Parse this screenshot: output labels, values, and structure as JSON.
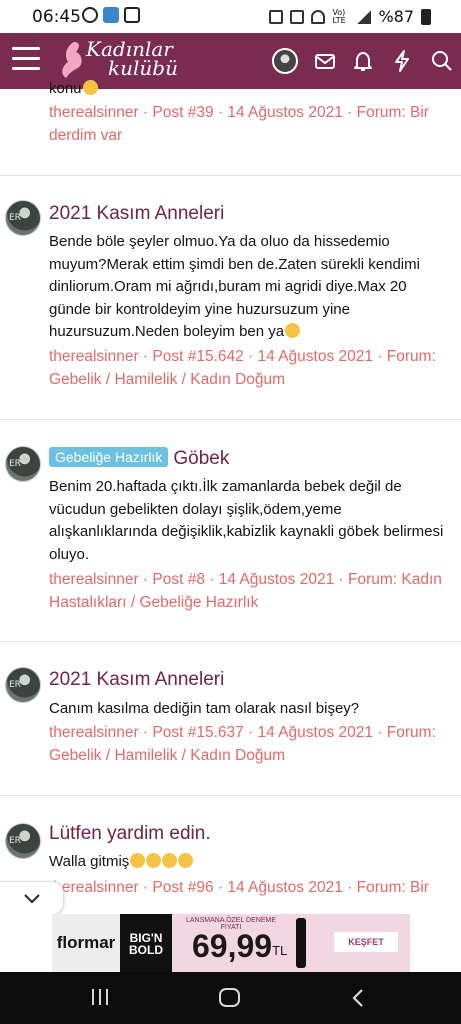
{
  "status_bar": {
    "time": "06:45",
    "network_label": "Vo) LTE",
    "battery": "%87"
  },
  "app_bar": {
    "logo_line1": "Kadınlar",
    "logo_line2": "kulübü",
    "icons": [
      "menu-icon",
      "avatar",
      "mail-icon",
      "bell-icon",
      "lightning-icon",
      "search-icon"
    ],
    "color": "#7a2c4e"
  },
  "results": [
    {
      "title": "",
      "prefix": "",
      "snippet": "konu",
      "emoji_count": 1,
      "meta_line1": "therealsinner · Post #39 · 14 Ağustos 2021 · Forum: Bir",
      "meta_line2": "derdim var"
    },
    {
      "title": "2021 Kasım Anneleri",
      "prefix": "",
      "snippet": "Bende böle şeyler olmuo.Ya da oluo da hissedemio muyum?Merak ettim şimdi ben de.Zaten sürekli kendimi dinliorum.Oram mi ağrıdı,buram mi agridi diye.Max 20 günde bir kontroldeyim yine huzursuzum yine huzursuzum.Neden boleyim ben ya",
      "emoji_count": 1,
      "meta_line1": "therealsinner · Post #15.642 · 14 Ağustos 2021 · Forum:",
      "meta_line2": "Gebelik / Hamilelik / Kadın Doğum"
    },
    {
      "title": "Göbek",
      "prefix": "Gebeliğe Hazırlık",
      "snippet": "Benim 20.haftada çıktı.İlk zamanlarda bebek değil de vücudun gebelikten dolayı şişlik,ödem,yeme alışkanlıklarında değişiklik,kabizlik kaynakli göbek belirmesi oluyo.",
      "emoji_count": 0,
      "meta_line1": "therealsinner · Post #8 · 14 Ağustos 2021 · Forum: Kadın",
      "meta_line2": "Hastalıkları / Gebeliğe Hazırlık"
    },
    {
      "title": "2021 Kasım Anneleri",
      "prefix": "",
      "snippet": "Canım kasılma dediğin tam olarak nasıl bişey?",
      "emoji_count": 0,
      "meta_line1": "therealsinner · Post #15.637 · 14 Ağustos 2021 · Forum:",
      "meta_line2": "Gebelik / Hamilelik / Kadın Doğum"
    },
    {
      "title": "Lütfen yardim edin.",
      "prefix": "",
      "snippet": "Walla gitmiş",
      "emoji_count": 4,
      "meta_line1": "therealsinner · Post #96 · 14 Ağustos 2021 · Forum: Bir",
      "meta_line2": ""
    }
  ],
  "avatar_initials": "ER",
  "ad": {
    "brand": "flormar",
    "product": "BIG'N BOLD",
    "promo": "LANSMANA ÖZEL DENEME FİYATI",
    "price": "69,99",
    "currency": "TL",
    "cta": "KEŞFET"
  },
  "colors": {
    "brand": "#7a2c4e",
    "title": "#6f2448",
    "meta": "#e06a6a",
    "prefix_badge": "#6cc0e0"
  }
}
